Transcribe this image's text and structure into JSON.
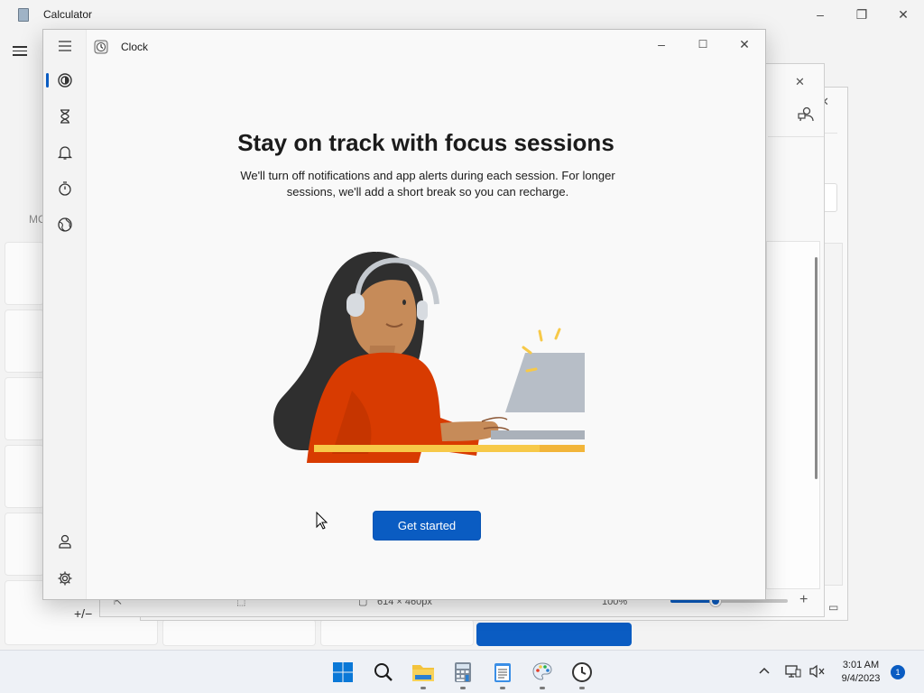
{
  "calculator": {
    "title": "Calculator",
    "mode_fragment": "MC",
    "plus_minus": "+/−"
  },
  "paint": {
    "canvas_size": "614 × 460px",
    "zoom": "100%",
    "zoom_minus": "−",
    "zoom_plus": "+"
  },
  "clock": {
    "title": "Clock",
    "headline": "Stay on track with focus sessions",
    "subtext": "We'll turn off notifications and app alerts during each session. For longer sessions, we'll add a short break so you can recharge.",
    "cta_label": "Get started",
    "nav_items": [
      "focus-sessions",
      "timer",
      "alarm",
      "stopwatch",
      "world-clock"
    ],
    "nav_bottom": [
      "account",
      "settings"
    ]
  },
  "taskbar": {
    "time": "3:01 AM",
    "date": "9/4/2023",
    "notification_count": "1",
    "pinned": [
      "start",
      "search",
      "file-explorer",
      "calculator",
      "notepad",
      "paint",
      "clock"
    ]
  },
  "colors": {
    "accent": "#0a5cc2",
    "shirt": "#d83b01",
    "hair": "#2f2f2f",
    "skin": "#c68b59",
    "desk": "#f7c948",
    "laptop": "#b7bec7"
  }
}
